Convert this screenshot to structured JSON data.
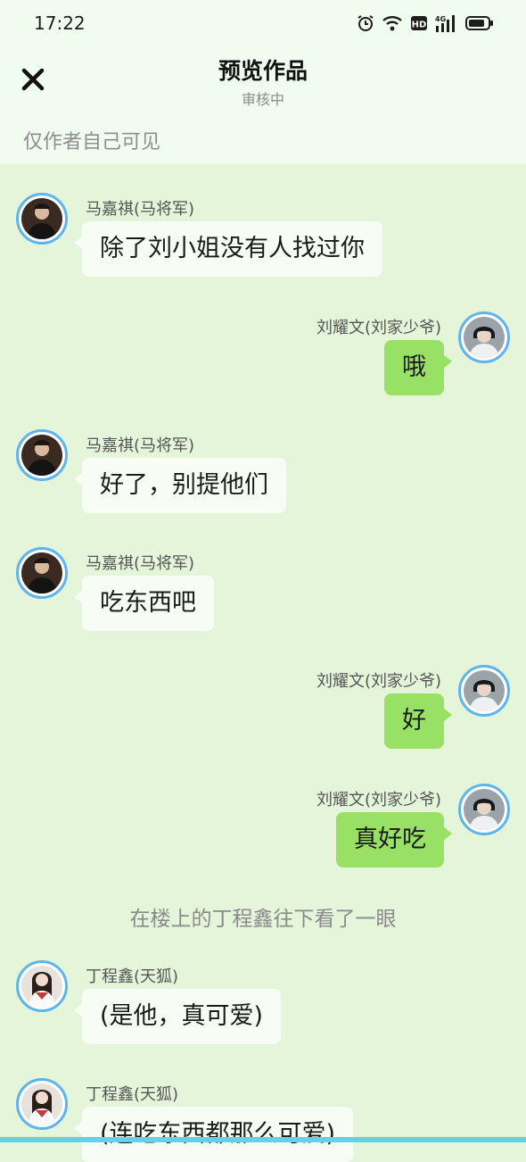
{
  "status": {
    "time": "17:22",
    "icons": [
      "alarm-icon",
      "wifi-icon",
      "hd-icon",
      "4g-signal-icon",
      "battery-icon"
    ],
    "hd_label": "HD",
    "net_label": "4G"
  },
  "header": {
    "title": "预览作品",
    "subtitle": "审核中",
    "close_icon": "close-icon",
    "visibility_note": "仅作者自己可见"
  },
  "colors": {
    "background": "#e4f5da",
    "header_bg": "#f1fcf0",
    "left_bubble": "#f7fcf4",
    "right_bubble": "#98e165",
    "avatar_ring": "#5db4ee"
  },
  "messages": [
    {
      "side": "left",
      "name": "马嘉祺(马将军)",
      "text": "除了刘小姐没有人找过你",
      "avatar": "avatar-majiaqi"
    },
    {
      "side": "right",
      "name": "刘耀文(刘家少爷)",
      "text": "哦",
      "avatar": "avatar-liuyaowen"
    },
    {
      "side": "left",
      "name": "马嘉祺(马将军)",
      "text": "好了，别提他们",
      "avatar": "avatar-majiaqi"
    },
    {
      "side": "left",
      "name": "马嘉祺(马将军)",
      "text": "吃东西吧",
      "avatar": "avatar-majiaqi"
    },
    {
      "side": "right",
      "name": "刘耀文(刘家少爷)",
      "text": "好",
      "avatar": "avatar-liuyaowen"
    },
    {
      "side": "right",
      "name": "刘耀文(刘家少爷)",
      "text": "真好吃",
      "avatar": "avatar-liuyaowen"
    },
    {
      "side": "left",
      "name": "丁程鑫(天狐)",
      "text": "(是他，真可爱)",
      "avatar": "avatar-dingchengxin"
    },
    {
      "side": "left",
      "name": "丁程鑫(天狐)",
      "text": "(连吃东西都那么可爱)",
      "avatar": "avatar-dingchengxin"
    }
  ],
  "narration": "在楼上的丁程鑫往下看了一眼"
}
